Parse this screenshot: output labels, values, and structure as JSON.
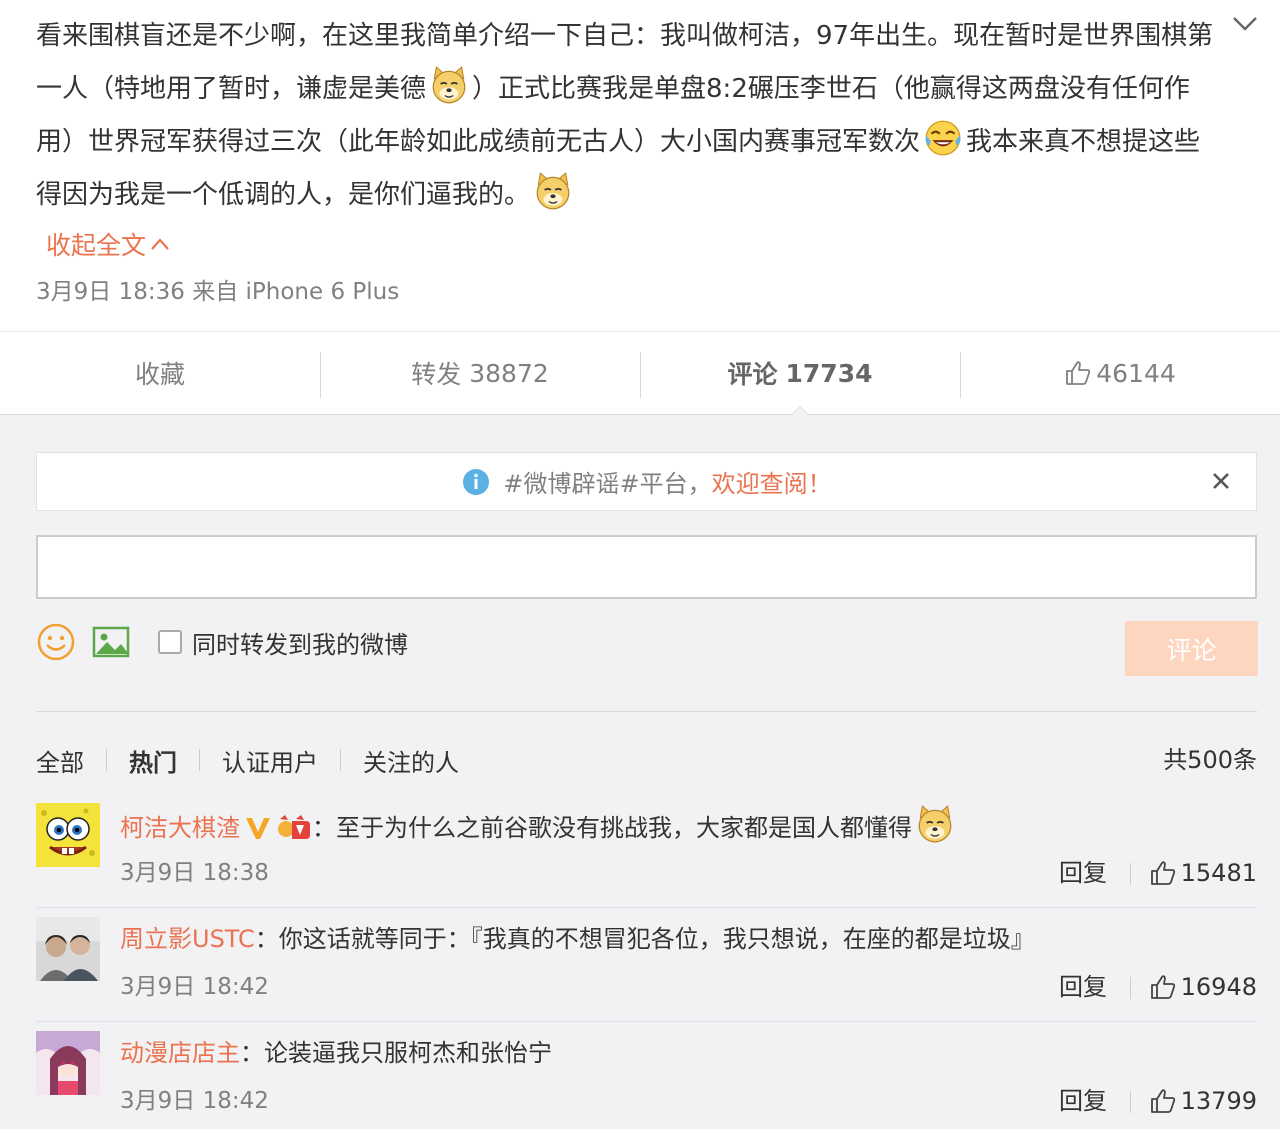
{
  "post": {
    "text_parts": [
      "看来围棋盲还是不少啊，在这里我简单介绍一下自己：我叫做柯洁，97年出生。现在暂时是世界围棋第一人（特地用了暂时，谦虚是美德",
      "）正式比赛我是单盘8:2碾压李世石（他赢得这两盘没有任何作用）世界冠军获得过三次（此年龄如此成绩前无古人）大小国内赛事冠军数次",
      "我本来真不想提这些得因为我是一个低调的人，是你们逼我的。"
    ],
    "collapse_label": "收起全文",
    "time": "3月9日 18:36",
    "from_prefix": "来自",
    "source": "iPhone 6 Plus"
  },
  "actions": {
    "favorite": "收藏",
    "forward_label": "转发",
    "forward_count": "38872",
    "comment_label": "评论",
    "comment_count": "17734",
    "like_count": "46144"
  },
  "notice": {
    "prefix": "#微博辟谣#平台，",
    "highlight": "欢迎查阅！"
  },
  "composer": {
    "input_value": "",
    "checkbox_label": "同时转发到我的微博",
    "submit_label": "评论"
  },
  "filters": {
    "all": "全部",
    "hot": "热门",
    "verified": "认证用户",
    "following": "关注的人",
    "total": "共500条"
  },
  "comments": [
    {
      "user": "柯洁大棋渣",
      "text": "：至于为什么之前谷歌没有挑战我，大家都是国人都懂得",
      "time": "3月9日 18:38",
      "reply": "回复",
      "likes": "15481"
    },
    {
      "user": "周立影USTC",
      "text": "：你这话就等同于：『我真的不想冒犯各位，我只想说，在座的都是垃圾』",
      "time": "3月9日 18:42",
      "reply": "回复",
      "likes": "16948"
    },
    {
      "user": "动漫店店主",
      "text": "：论装逼我只服柯杰和张怡宁",
      "time": "3月9日 18:42",
      "reply": "回复",
      "likes": "13799"
    }
  ],
  "colors": {
    "accent": "#eb7350",
    "muted": "#808080",
    "comment_bg": "#f2f2f5",
    "submit_disabled": "#fed6c0",
    "verified_v": "#f5a623"
  },
  "icons": [
    "chevron-down-icon",
    "doge-emoji-icon",
    "laugh-cry-emoji-icon",
    "chevron-up-icon",
    "thumb-up-icon",
    "info-icon",
    "close-icon",
    "smiley-icon",
    "image-icon",
    "verified-v-icon",
    "vip-badge-icon"
  ]
}
